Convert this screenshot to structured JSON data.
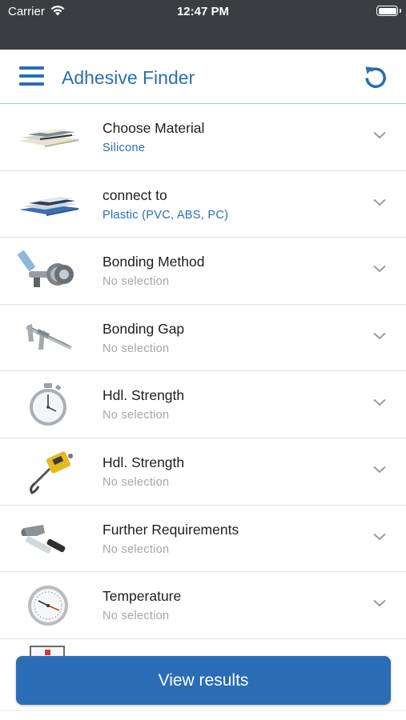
{
  "status_bar": {
    "carrier": "Carrier",
    "time": "12:47 PM"
  },
  "header": {
    "title": "Adhesive Finder"
  },
  "filters": [
    {
      "label": "Choose Material",
      "value": "Silicone",
      "selected": true,
      "icon": "material-samples-icon"
    },
    {
      "label": "connect to",
      "value": "Plastic (PVC, ABS, PC)",
      "selected": true,
      "icon": "plastic-samples-icon"
    },
    {
      "label": "Bonding Method",
      "value": "No selection",
      "selected": false,
      "icon": "dispenser-gun-icon"
    },
    {
      "label": "Bonding Gap",
      "value": "No selection",
      "selected": false,
      "icon": "caliper-icon"
    },
    {
      "label": "Hdl. Strength",
      "value": "No selection",
      "selected": false,
      "icon": "stopwatch-icon"
    },
    {
      "label": "Hdl. Strength",
      "value": "No selection",
      "selected": false,
      "icon": "force-gauge-icon"
    },
    {
      "label": "Further Requirements",
      "value": "No selection",
      "selected": false,
      "icon": "hammer-icon"
    },
    {
      "label": "Temperature",
      "value": "No selection",
      "selected": false,
      "icon": "thermometer-dial-icon"
    }
  ],
  "footer": {
    "button_label": "View results"
  },
  "colors": {
    "accent": "#2a6db4",
    "status_bar": "#3b3d40",
    "placeholder": "#a6a6a6"
  }
}
